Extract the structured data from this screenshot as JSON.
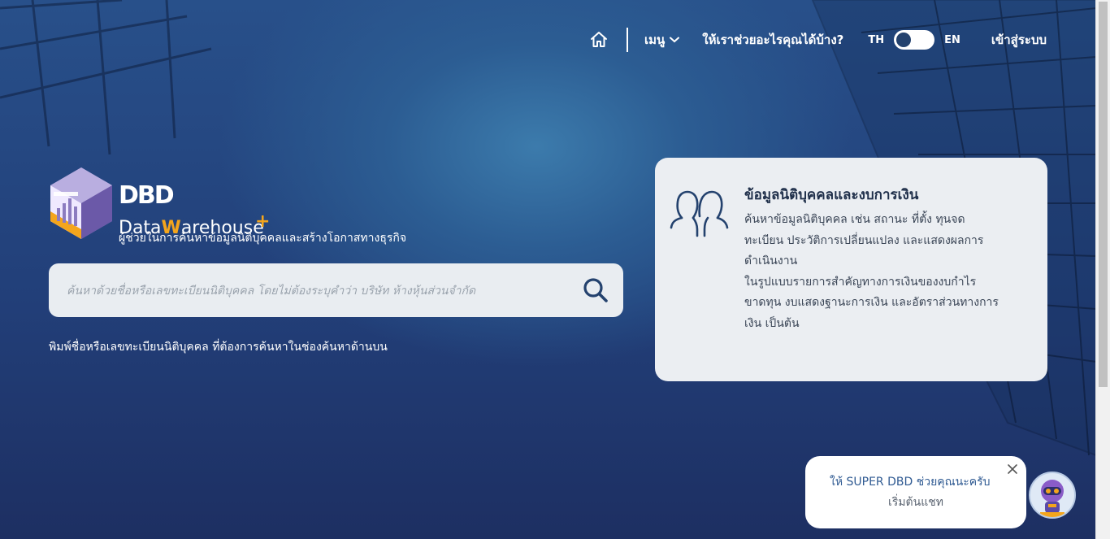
{
  "nav": {
    "menu_label": "เมนู",
    "help_label": "ให้เราช่วยอะไรคุณได้บ้าง?",
    "lang_th": "TH",
    "lang_en": "EN",
    "login_label": "เข้าสู่ระบบ"
  },
  "logo": {
    "dbd": "DBD",
    "data": "Data",
    "ware": "W",
    "arehouse": "arehouse",
    "plus": "+",
    "tagline": "ผู้ช่วยในการค้นหาข้อมูลนิติบุคคลและสร้างโอกาสทางธุรกิจ"
  },
  "search": {
    "placeholder": "ค้นหาด้วยชื่อหรือเลขทะเบียนนิติบุคคล โดยไม่ต้องระบุคำว่า บริษัท ห้างหุ้นส่วนจำกัด",
    "value": "",
    "hint": "พิมพ์ชื่อหรือเลขทะเบียนนิติบุคคล ที่ต้องการค้นหาในช่องค้นหาด้านบน"
  },
  "card": {
    "title": "ข้อมูลนิติบุคคลและงบการเงิน",
    "lines": [
      "ค้นหาข้อมูลนิติบุคคล เช่น สถานะ ที่ตั้ง ทุนจด",
      "ทะเบียน ประวัติการเปลี่ยนแปลง และแสดงผลการ",
      "ดำเนินงาน",
      "ในรูปแบบรายการสำคัญทางการเงินของงบกำไร",
      "ขาดทุน งบแสดงฐานะการเงิน และอัตราส่วนทางการ",
      "เงิน เป็นต้น"
    ]
  },
  "chat": {
    "line1": "ให้ SUPER DBD ช่วยคุณนะครับ",
    "line2": "เริ่มต้นแชท"
  },
  "colors": {
    "accent": "#f4a51c",
    "navy": "#1f2f4a",
    "card_bg": "#ebeef2",
    "chat_text": "#2f5a92"
  },
  "icons": {
    "home": "home-icon",
    "menu_chevron": "chevron-down-icon",
    "search": "search-icon",
    "people": "people-icon",
    "close": "close-icon"
  }
}
